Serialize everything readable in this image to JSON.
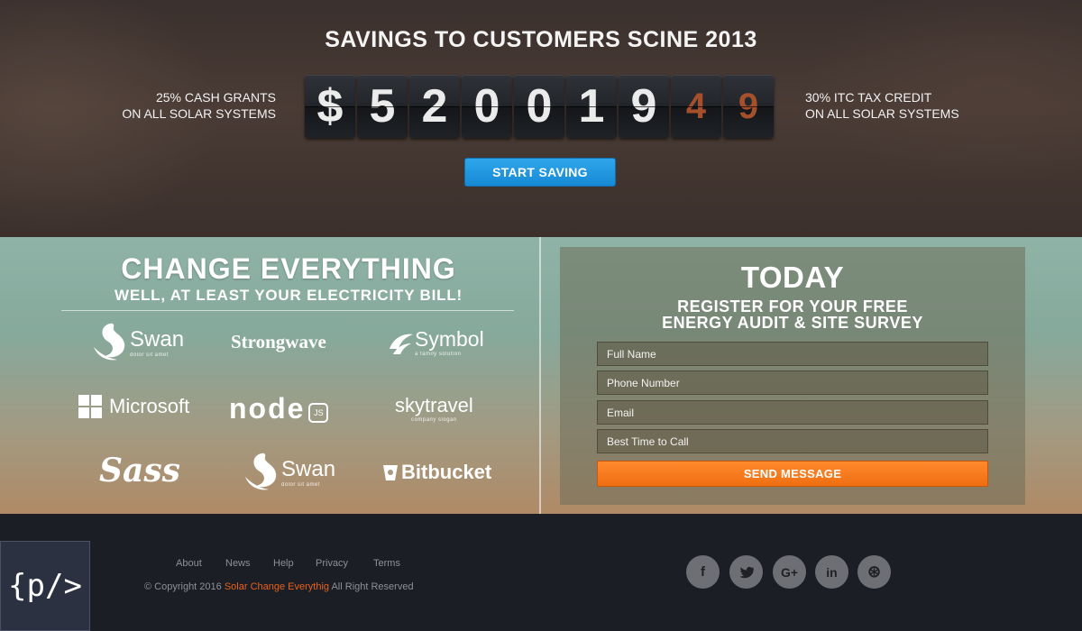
{
  "hero": {
    "title": "SAVINGS TO CUSTOMERS SCINE 2013",
    "left_line1": "25% CASH GRANTS",
    "left_line2": "ON ALL SOLAR SYSTEMS",
    "right_line1": "30% ITC TAX CREDIT",
    "right_line2": "ON ALL SOLAR SYSTEMS",
    "counter_digits": [
      "$",
      "5",
      "2",
      "0",
      "0",
      "1",
      "9"
    ],
    "counter_cents": [
      "4",
      "9"
    ],
    "start_button": "START SAVING",
    "accent_color": "#1b95e0"
  },
  "clients": {
    "title": "CHANGE EVERYTHING",
    "subtitle": "WELL, AT LEAST YOUR ELECTRICITY BILL!",
    "logos": [
      {
        "name": "Swan",
        "sub": "dolor sit amet",
        "icon": "swan-icon"
      },
      {
        "name": "Strongwave",
        "sub": "",
        "icon": ""
      },
      {
        "name": "Symbol",
        "sub": "a family solution",
        "icon": "symbol-icon"
      },
      {
        "name": "Microsoft",
        "sub": "",
        "icon": "windows-icon"
      },
      {
        "name": "node",
        "sub": "JS",
        "icon": "hexagon-icon"
      },
      {
        "name": "skytravel",
        "sub": "company slogan",
        "icon": ""
      },
      {
        "name": "Sass",
        "sub": "",
        "icon": ""
      },
      {
        "name": "Swan",
        "sub": "dolor sit amet",
        "icon": "swan-icon"
      },
      {
        "name": "Bitbucket",
        "sub": "",
        "icon": "bucket-icon"
      }
    ]
  },
  "form": {
    "title": "TODAY",
    "register_line1": "REGISTER FOR YOUR FREE",
    "register_line2": "ENERGY AUDIT & SITE SURVEY",
    "fields": [
      {
        "placeholder": "Full Name",
        "value": ""
      },
      {
        "placeholder": "Phone Number",
        "value": ""
      },
      {
        "placeholder": "Email",
        "value": ""
      },
      {
        "placeholder": "Best Time to Call",
        "value": ""
      }
    ],
    "send_button": "SEND MESSAGE",
    "button_color": "#f47a20"
  },
  "footer": {
    "logo_text": "{p/>",
    "links": [
      "About",
      "News",
      "Help",
      "Privacy",
      "Terms"
    ],
    "copyright_prefix": "© Copyright 2016",
    "brand": "Solar Change Everythig",
    "copyright_suffix": "All Right Reserved",
    "social": [
      {
        "icon": "facebook-icon",
        "glyph": "f"
      },
      {
        "icon": "twitter-icon",
        "glyph": "🐦"
      },
      {
        "icon": "google-plus-icon",
        "glyph": "G+"
      },
      {
        "icon": "linkedin-icon",
        "glyph": "in"
      },
      {
        "icon": "dribbble-icon",
        "glyph": "⊛"
      }
    ]
  }
}
